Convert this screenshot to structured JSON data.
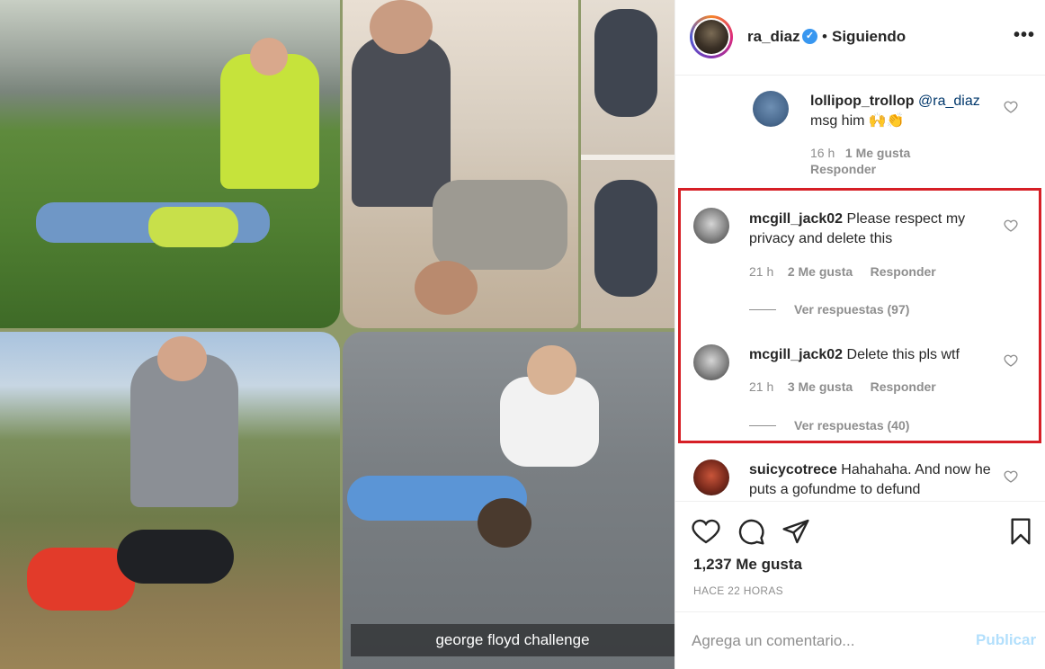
{
  "post": {
    "caption_overlay": "george floyd challenge"
  },
  "header": {
    "username": "ra_diaz",
    "verified_mark": "✓",
    "separator": "•",
    "follow_status": "Siguiendo",
    "more_icon": "more-options-icon",
    "more_glyph": "•••"
  },
  "comments": [
    {
      "username": "lollipop_trollop",
      "mention": "@ra_diaz",
      "text": "msg him 🙌👏",
      "time": "16 h",
      "likes": "1 Me gusta",
      "reply_label": "Responder"
    },
    {
      "username": "mcgill_jack02",
      "text": "Please respect my privacy and delete this",
      "time": "21 h",
      "likes": "2 Me gusta",
      "reply_label": "Responder",
      "view_replies": "Ver respuestas (97)"
    },
    {
      "username": "mcgill_jack02",
      "text": "Delete this pls wtf",
      "time": "21 h",
      "likes": "3 Me gusta",
      "reply_label": "Responder",
      "view_replies": "Ver respuestas (40)"
    },
    {
      "username": "suicycotrece",
      "text": "Hahahaha. And now he puts a gofundme to defund"
    }
  ],
  "actions": {
    "like_icon": "heart-icon",
    "comment_icon": "comment-icon",
    "share_icon": "share-icon",
    "save_icon": "bookmark-icon",
    "likes_count": "1,237 Me gusta",
    "timestamp": "HACE 22 HORAS"
  },
  "add_comment": {
    "placeholder": "Agrega un comentario...",
    "publish_label": "Publicar"
  },
  "colors": {
    "highlight_border": "#d61f26",
    "verified": "#3897f0",
    "mention": "#00376b",
    "publish_disabled": "#b2dffc"
  }
}
